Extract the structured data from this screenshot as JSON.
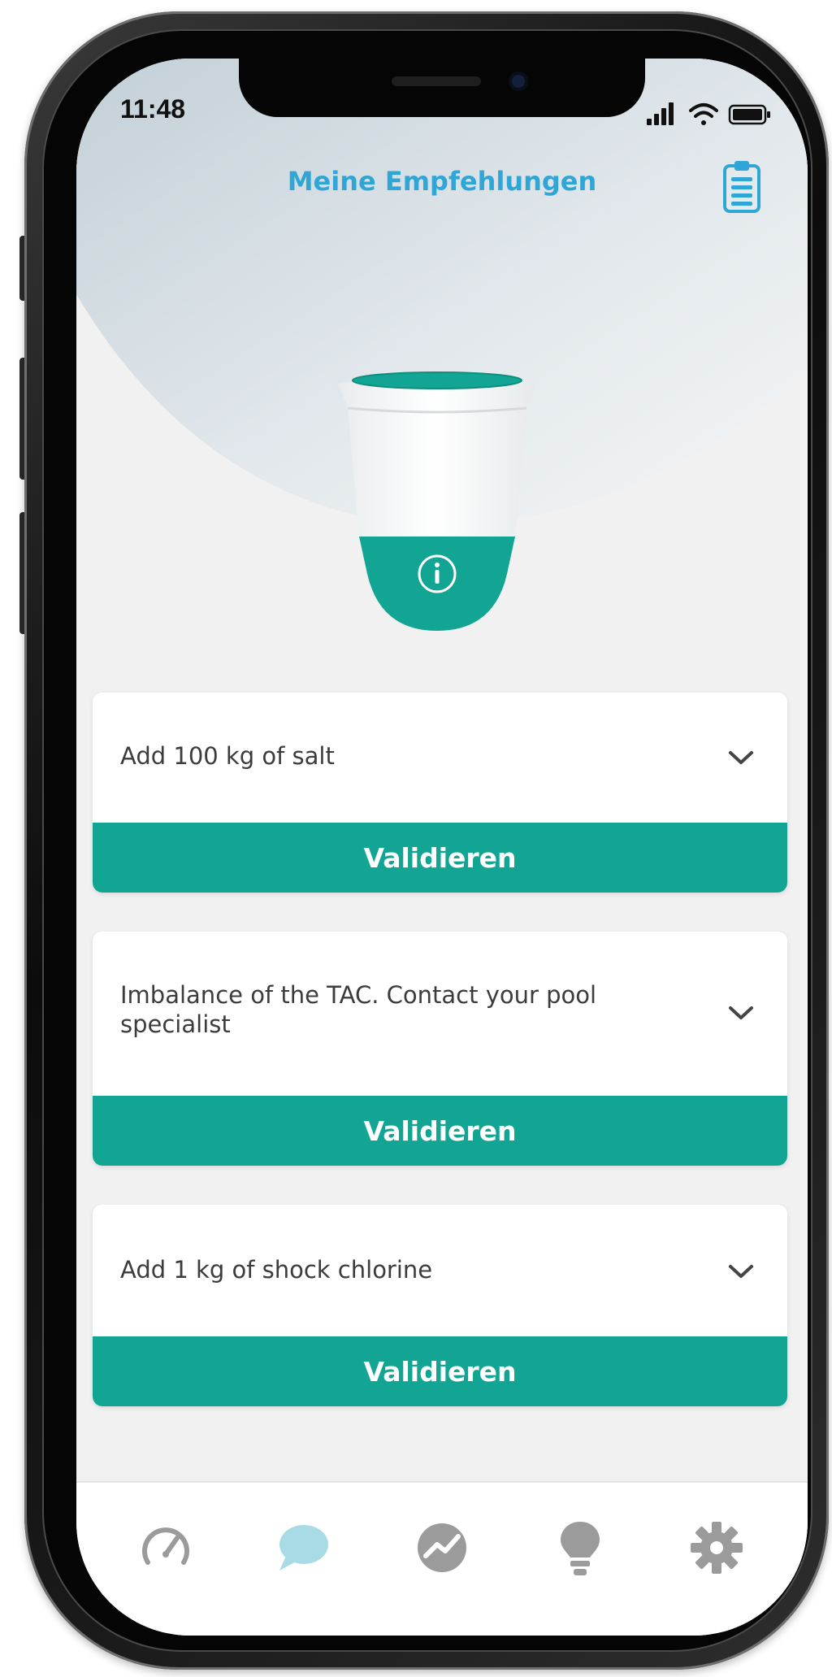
{
  "status_bar": {
    "time": "11:48"
  },
  "header": {
    "title": "Meine Empfehlungen",
    "icon": "clipboard-icon"
  },
  "device": {
    "info_icon": "info-icon"
  },
  "recommendations": [
    {
      "text": "Add 100 kg of salt",
      "button_label": "Validieren"
    },
    {
      "text": "Imbalance of the TAC. Contact your pool specialist",
      "button_label": "Validieren"
    },
    {
      "text": "Add 1 kg of shock chlorine",
      "button_label": "Validieren"
    }
  ],
  "tab_bar": {
    "items": [
      {
        "icon": "gauge-icon",
        "active": false
      },
      {
        "icon": "chat-bubble-icon",
        "active": true
      },
      {
        "icon": "trend-chart-icon",
        "active": false
      },
      {
        "icon": "lightbulb-icon",
        "active": false
      },
      {
        "icon": "gear-icon",
        "active": false
      }
    ]
  },
  "colors": {
    "accent_teal": "#12a594",
    "title_blue": "#2fa6d6",
    "active_tab": "#a9dbe6",
    "inactive_tab": "#9b9b9b"
  }
}
